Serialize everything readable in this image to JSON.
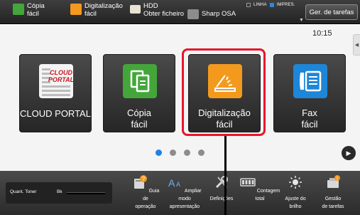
{
  "topbar": {
    "shortcuts": [
      {
        "line1": "Cópia",
        "line2": "fácil",
        "icon": "copy-icon"
      },
      {
        "line1": "Digitalização",
        "line2": "fácil",
        "icon": "scan-icon"
      },
      {
        "line1": "HDD",
        "line2": "Obter ficheiro",
        "icon": "folder-icon"
      },
      {
        "line1": "Sharp OSA",
        "line2": "",
        "icon": "osa-icon"
      }
    ],
    "status_linha": "LINHA",
    "status_impres": "IMPRES.",
    "tasks_button": "Ger. de tarefas"
  },
  "clock": "10:15",
  "tiles": [
    {
      "label_line1": "CLOUD PORTAL",
      "label_line2": "",
      "icon_text_1": "CLOUD",
      "icon_text_2": "PORTAL",
      "color": "#c5161d"
    },
    {
      "label_line1": "Cópia",
      "label_line2": "fácil",
      "color": "#44a63a"
    },
    {
      "label_line1": "Digitalização",
      "label_line2": "fácil",
      "color": "#f39a1e"
    },
    {
      "label_line1": "Fax",
      "label_line2": "fácil",
      "color": "#1e86d8"
    }
  ],
  "pager": {
    "pages": 4,
    "active_page": 1
  },
  "bottombar": {
    "toner_label": "Quant. Toner",
    "toner_color": "Bk",
    "toner_level": 0,
    "items": [
      {
        "line1": "Guia de",
        "line2": "operação"
      },
      {
        "line1": "Ampliar modo",
        "line2": "apresentação"
      },
      {
        "line1": "Definições",
        "line2": ""
      },
      {
        "line1": "Contagem total",
        "line2": ""
      },
      {
        "line1": "Ajuste do",
        "line2": "brilho"
      },
      {
        "line1": "Gestão",
        "line2": "de tarefas"
      }
    ]
  },
  "colors": {
    "accent": "#2180e8",
    "highlight": "#e8152b"
  }
}
